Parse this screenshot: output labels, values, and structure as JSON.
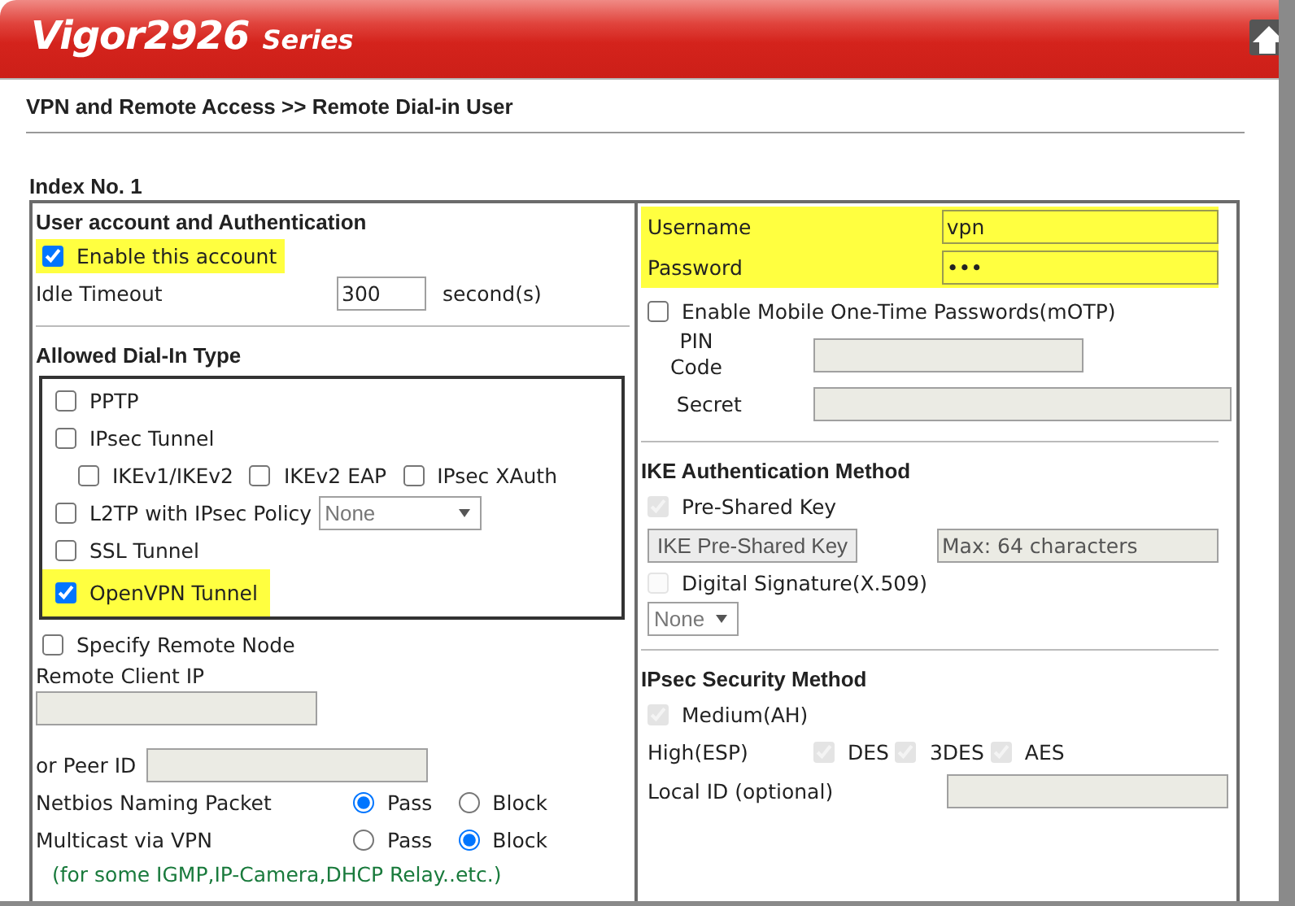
{
  "header": {
    "brand": "Vigor2926",
    "series": "Series"
  },
  "breadcrumb": "VPN and Remote Access >> Remote Dial-in User",
  "index_label": "Index No. 1",
  "account": {
    "title": "User account and Authentication",
    "enable": {
      "label": "Enable this account",
      "checked": true,
      "highlighted": true
    },
    "idle_timeout": {
      "label": "Idle Timeout",
      "value": "300",
      "unit": "second(s)"
    }
  },
  "dial_in": {
    "title": "Allowed Dial-In Type",
    "options": [
      {
        "kind": "checkbox",
        "label": "PPTP",
        "checked": false,
        "highlighted": false
      },
      {
        "kind": "checkbox",
        "label": "IPsec Tunnel",
        "checked": false,
        "highlighted": false
      },
      {
        "kind": "suboptions",
        "children": [
          {
            "label": "IKEv1/IKEv2",
            "checked": false
          },
          {
            "label": "IKEv2 EAP",
            "checked": false
          },
          {
            "label": "IPsec XAuth",
            "checked": false
          }
        ]
      },
      {
        "kind": "select",
        "label": "L2TP with IPsec Policy",
        "checked": false,
        "highlighted": false,
        "select": "None"
      },
      {
        "kind": "checkbox",
        "label": "SSL Tunnel",
        "checked": false,
        "highlighted": false
      },
      {
        "kind": "checkbox",
        "label": "OpenVPN Tunnel",
        "checked": true,
        "highlighted": true
      }
    ]
  },
  "remote": {
    "specify": {
      "label": "Specify Remote Node",
      "checked": false
    },
    "client_ip": {
      "label": "Remote Client IP"
    },
    "peer_id": {
      "label": "or Peer ID"
    },
    "radios": [
      {
        "label": "Netbios Naming Packet",
        "options": [
          {
            "label": "Pass",
            "selected": true
          },
          {
            "label": "Block",
            "selected": false
          }
        ]
      },
      {
        "label": "Multicast via VPN",
        "options": [
          {
            "label": "Pass",
            "selected": false
          },
          {
            "label": "Block",
            "selected": true
          }
        ]
      }
    ],
    "note": "(for some IGMP,IP-Camera,DHCP Relay..etc.)"
  },
  "credentials": [
    {
      "label": "Username",
      "value": "vpn",
      "highlighted": true
    },
    {
      "label": "Password",
      "value": "•••",
      "highlighted": true
    }
  ],
  "motp": {
    "label": "Enable Mobile One-Time Passwords(mOTP)",
    "checked": false,
    "pin_label": "PIN Code",
    "secret_label": "Secret"
  },
  "ike": {
    "title": "IKE Authentication Method",
    "psk": {
      "label": "Pre-Shared Key",
      "checked": true,
      "disabled": true
    },
    "psk_button": "IKE Pre-Shared Key",
    "psk_placeholder": "Max: 64 characters",
    "signature": {
      "label": "Digital Signature(X.509)",
      "checked": false,
      "disabled": true
    },
    "select": "None"
  },
  "ipsec": {
    "title": "IPsec Security Method",
    "medium": {
      "label": "Medium(AH)",
      "checked": true,
      "disabled": true
    },
    "high_label": "High(ESP)",
    "ciphers": [
      {
        "label": "DES",
        "checked": true,
        "disabled": true
      },
      {
        "label": "3DES",
        "checked": true,
        "disabled": true
      },
      {
        "label": "AES",
        "checked": true,
        "disabled": true
      }
    ],
    "local_id": {
      "label": "Local ID (optional)"
    }
  }
}
